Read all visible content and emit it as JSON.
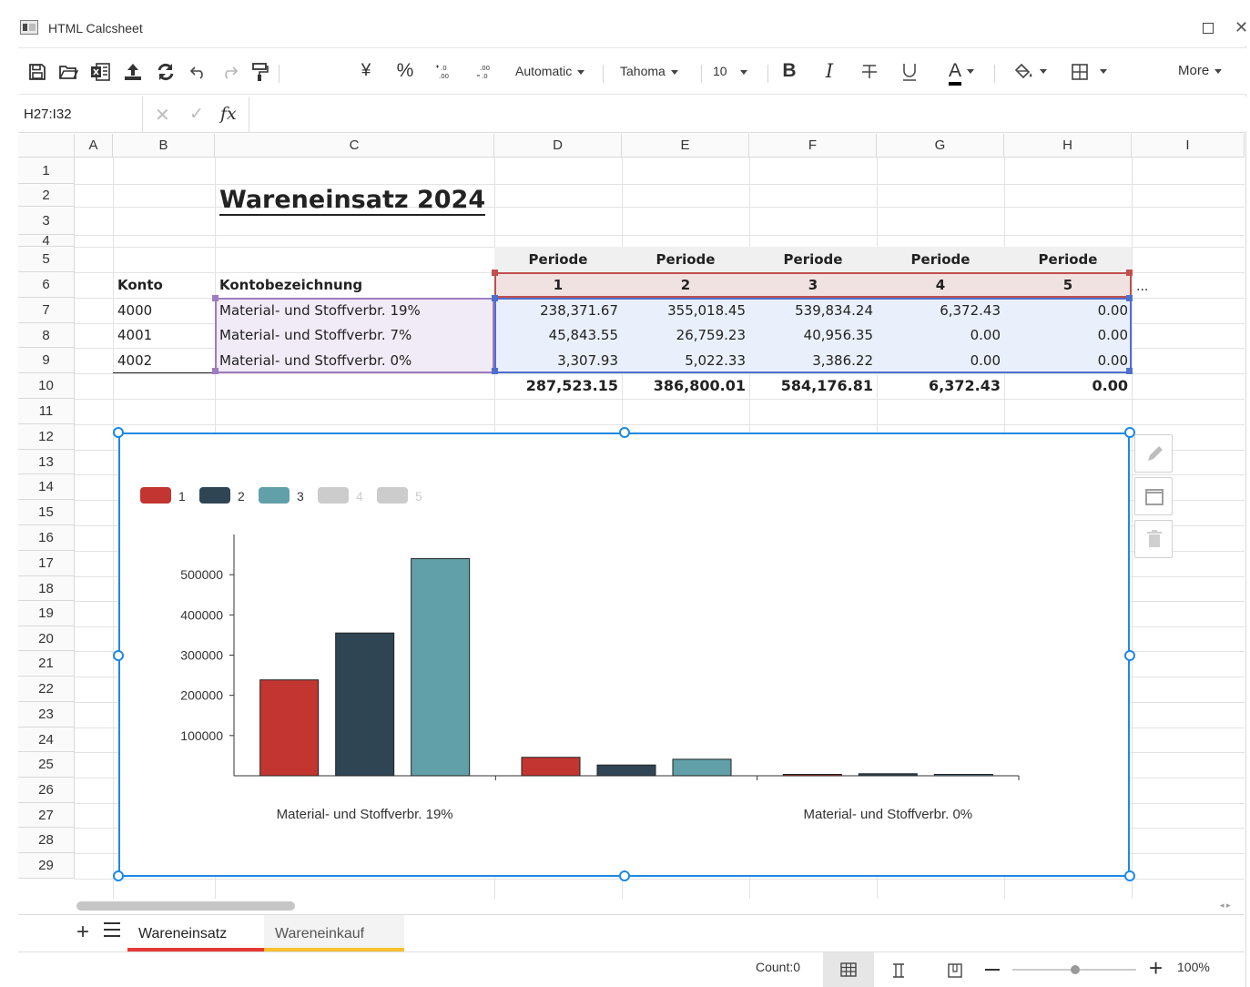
{
  "app": {
    "title": "HTML Calcsheet"
  },
  "toolbar": {
    "number_format": "Automatic",
    "font_name": "Tahoma",
    "font_size": "10",
    "currency_symbol": "¥",
    "percent_symbol": "%",
    "bold": "B",
    "italic": "I",
    "font_color_letter": "A",
    "more": "More"
  },
  "formula_bar": {
    "name_box": "H27:I32",
    "fx": "fx",
    "formula": ""
  },
  "columns": [
    "A",
    "B",
    "C",
    "D",
    "E",
    "F",
    "G",
    "H",
    "I"
  ],
  "rows": [
    "1",
    "2",
    "3",
    "4",
    "5",
    "6",
    "7",
    "8",
    "9",
    "10",
    "11",
    "12",
    "13",
    "14",
    "15",
    "16",
    "17",
    "18",
    "19",
    "20",
    "21",
    "22",
    "23",
    "24",
    "25",
    "26",
    "27",
    "28",
    "29"
  ],
  "sheet": {
    "title": "Wareneinsatz 2024",
    "period_label": "Periode",
    "periods": [
      "1",
      "2",
      "3",
      "4",
      "5"
    ],
    "more_indicator": "...",
    "header_konto": "Konto",
    "header_bezeichnung": "Kontobezeichnung",
    "accounts": [
      {
        "konto": "4000",
        "name": "Material- und Stoffverbr. 19%",
        "values": [
          "238,371.67",
          "355,018.45",
          "539,834.24",
          "6,372.43",
          "0.00"
        ]
      },
      {
        "konto": "4001",
        "name": "Material- und Stoffverbr. 7%",
        "values": [
          "45,843.55",
          "26,759.23",
          "40,956.35",
          "0.00",
          "0.00"
        ]
      },
      {
        "konto": "4002",
        "name": "Material- und Stoffverbr. 0%",
        "values": [
          "3,307.93",
          "5,022.33",
          "3,386.22",
          "0.00",
          "0.00"
        ]
      }
    ],
    "totals": [
      "287,523.15",
      "386,800.01",
      "584,176.81",
      "6,372.43",
      "0.00"
    ]
  },
  "chart_data": {
    "type": "bar",
    "categories": [
      "Material- und Stoffverbr. 19%",
      "Material- und Stoffverbr. 7%",
      "Material- und Stoffverbr. 0%"
    ],
    "category_labels_shown": [
      "Material- und Stoffverbr. 19%",
      "",
      "Material- und Stoffverbr. 0%"
    ],
    "series": [
      {
        "name": "1",
        "color": "#c23531",
        "values": [
          238371.67,
          45843.55,
          3307.93
        ]
      },
      {
        "name": "2",
        "color": "#2f4554",
        "values": [
          355018.45,
          26759.23,
          5022.33
        ]
      },
      {
        "name": "3",
        "color": "#61a0a8",
        "values": [
          539834.24,
          40956.35,
          3386.22
        ]
      },
      {
        "name": "4",
        "color": "#cccccc",
        "hidden": true,
        "values": [
          6372.43,
          0,
          0
        ]
      },
      {
        "name": "5",
        "color": "#cccccc",
        "hidden": true,
        "values": [
          0,
          0,
          0
        ]
      }
    ],
    "yticks": [
      100000,
      200000,
      300000,
      400000,
      500000
    ],
    "ylim": [
      0,
      600000
    ],
    "legend_position": "top-left",
    "grid": false
  },
  "sheet_tabs": [
    {
      "name": "Wareneinsatz",
      "color": "#e53935",
      "active": true
    },
    {
      "name": "Wareneinkauf",
      "color": "#fbc02d",
      "active": false
    }
  ],
  "status": {
    "count": "Count:0",
    "zoom": "100%"
  },
  "colors": {
    "selection": "#1e88e5",
    "range_red": "#c0504d",
    "range_purple": "#9e7cc1",
    "range_blue": "#4f6fcf"
  }
}
